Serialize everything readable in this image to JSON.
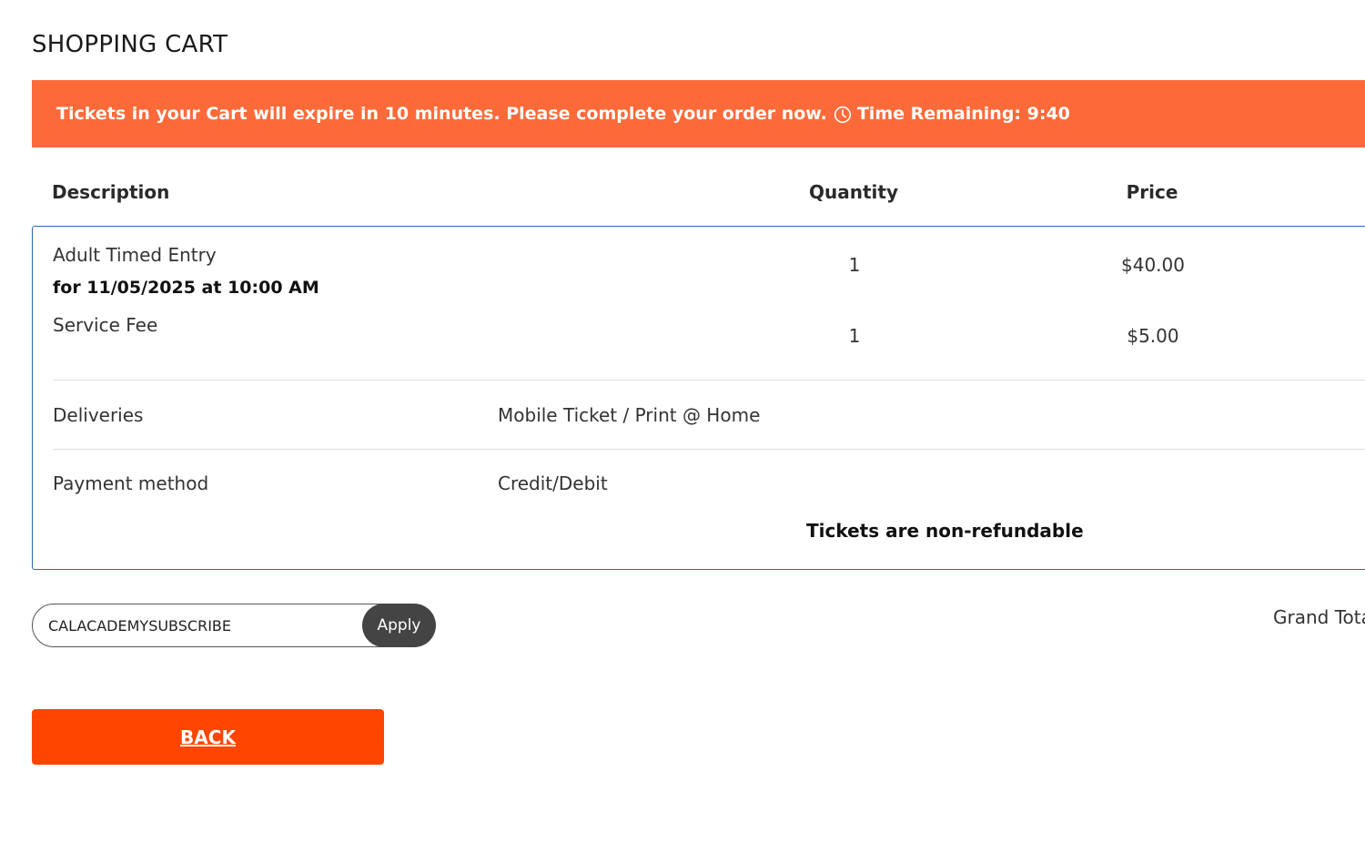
{
  "page": {
    "title": "SHOPPING CART"
  },
  "banner": {
    "message": "Tickets in your Cart will expire in 10 minutes. Please complete your order now.",
    "icon": "clock-icon",
    "timer_text": "Time Remaining: 9:40",
    "background_color": "#fd6a3a"
  },
  "table": {
    "headers": {
      "description": "Description",
      "quantity": "Quantity",
      "price": "Price"
    },
    "items": [
      {
        "name": "Adult Timed Entry",
        "detail": "for 11/05/2025 at 10:00 AM",
        "quantity": "1",
        "price": "$40.00"
      },
      {
        "name": "Service Fee",
        "quantity": "1",
        "price": "$5.00"
      }
    ],
    "deliveries": {
      "label": "Deliveries",
      "value": "Mobile Ticket / Print @ Home"
    },
    "payment": {
      "label": "Payment method",
      "value": "Credit/Debit"
    },
    "refund_note": "Tickets are non-refundable",
    "border_color": "#2b6aa8"
  },
  "promo": {
    "code_value": "CALACADEMYSUBSCRIBE",
    "apply_label": "Apply"
  },
  "summary": {
    "grand_total_label": "Grand Tota"
  },
  "actions": {
    "back_label": "BACK",
    "back_color": "#ff4500"
  }
}
